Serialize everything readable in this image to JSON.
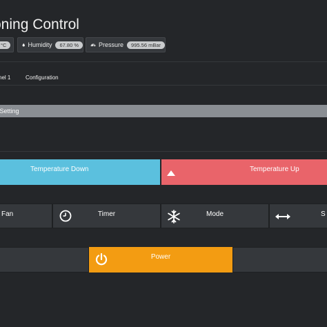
{
  "header": {
    "title": "oning Control"
  },
  "sensors": {
    "temperature": {
      "value": "°C"
    },
    "humidity": {
      "label": "Humidity",
      "value": "67.80 %"
    },
    "pressure": {
      "label": "Pressure",
      "value": "995.56 mBar"
    }
  },
  "tabs": [
    {
      "label": "nel 1"
    },
    {
      "label": "Configuration"
    }
  ],
  "section": {
    "title": "ure Setting"
  },
  "controls": {
    "temp_down": "Temperature Down",
    "temp_up": "Temperature Up",
    "fan": "Fan",
    "timer": "Timer",
    "mode": "Mode",
    "swing": "S",
    "power": "Power"
  },
  "colors": {
    "temp_down": "#5bc0de",
    "temp_up": "#e9646a",
    "power": "#f39c12"
  },
  "icons": [
    "droplet-icon",
    "gauge-icon",
    "triangle-up-icon",
    "clock-icon",
    "snowflake-icon",
    "horizontal-arrows-icon",
    "power-icon"
  ]
}
